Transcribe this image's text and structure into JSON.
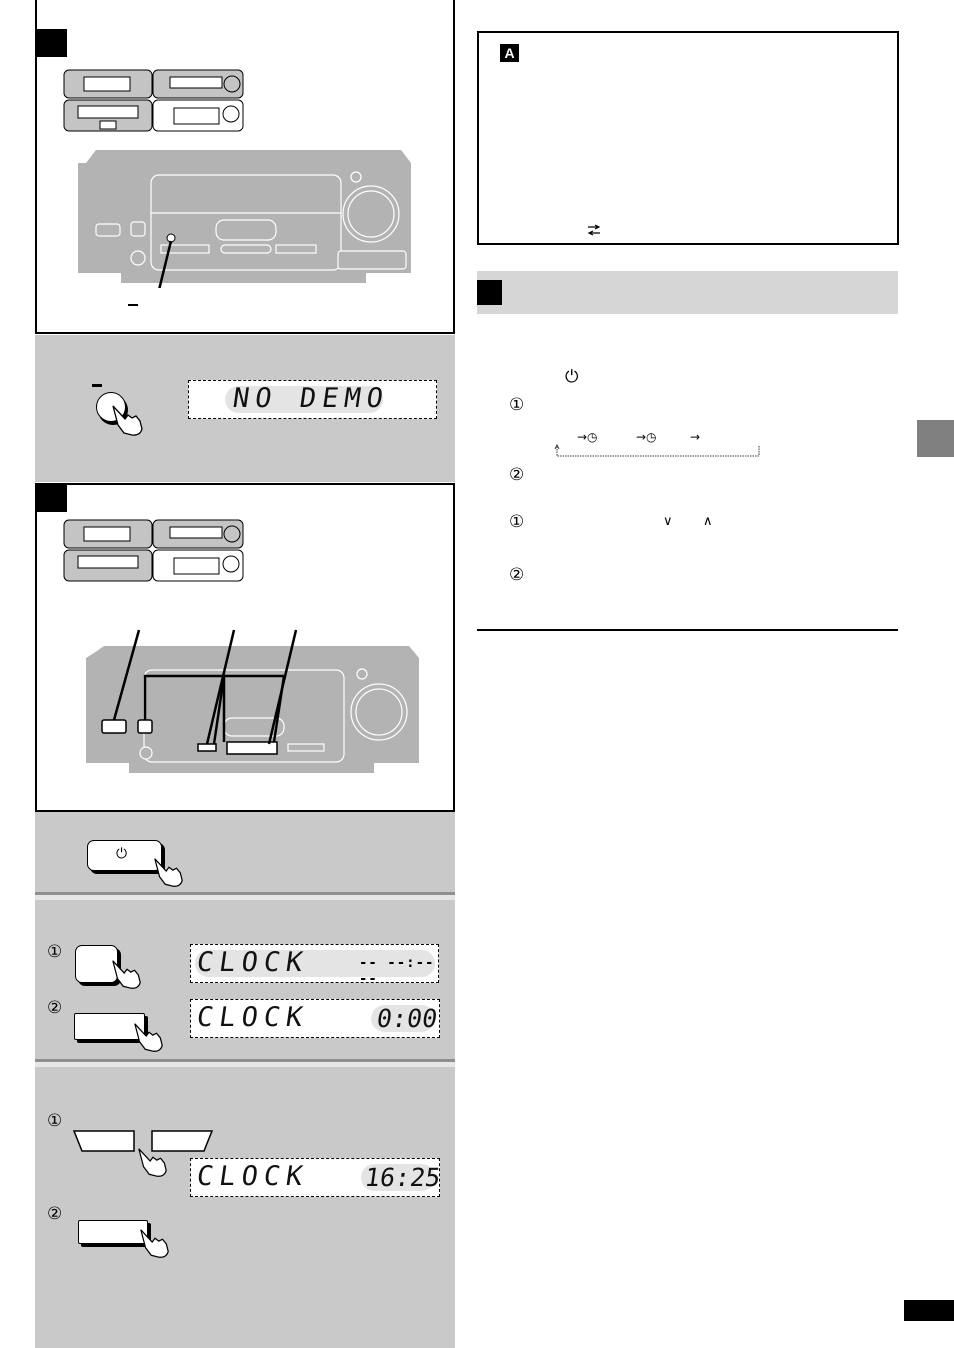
{
  "left": {
    "demo_display": "NO DEMO",
    "clock_display_1": {
      "label": "CLOCK",
      "value": "-- --:-- --"
    },
    "clock_display_2": {
      "label": "CLOCK",
      "value": "0:00"
    },
    "clock_display_3": {
      "label": "CLOCK",
      "value": "16:25"
    },
    "step_markers": [
      "①",
      "②",
      "①",
      "②"
    ],
    "power_symbol": "⏻"
  },
  "right": {
    "note_box_badge": "A",
    "note_box_icon": "swap-arrows-icon",
    "power_symbol": "⏻",
    "step_markers": [
      "①",
      "②",
      "①",
      "②"
    ],
    "sequence_arrows": [
      "→◷",
      "→◷",
      "→"
    ],
    "down_symbol": "∨",
    "up_symbol": "∧"
  },
  "colors": {
    "panel_gray": "#c9c9c9",
    "device_gray": "#b3b3b3",
    "side_tab": "#808080"
  }
}
